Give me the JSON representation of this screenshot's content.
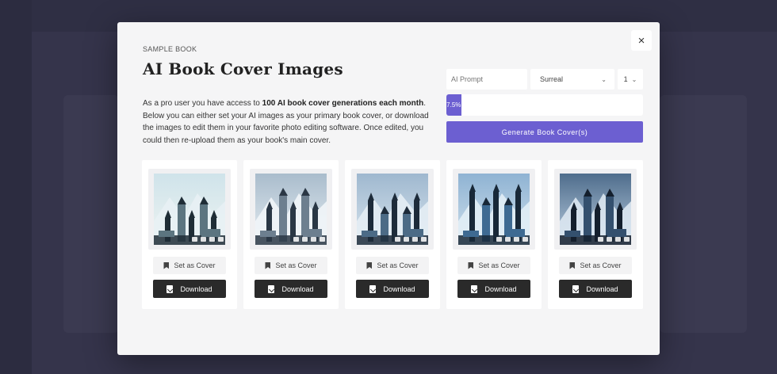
{
  "modal": {
    "eyebrow": "SAMPLE BOOK",
    "title": "AI Book Cover Images",
    "description_pre": "As a pro user you have access to ",
    "description_bold": "100 AI book cover generations each month",
    "description_post": ". Below you can either set your AI images as your primary book cover, or download the images to edit them in your favorite photo editing software. Once edited, you could then re-upload them as your book's main cover.",
    "close_icon": "×"
  },
  "controls": {
    "prompt_placeholder": "AI Prompt",
    "style_value": "Surreal",
    "count_value": "1",
    "progress_label": "7.5%",
    "progress_value": 0.075,
    "generate_label": "Generate Book Cover(s)",
    "accent": "#6c5fd1"
  },
  "cards": [
    {
      "set_cover_label": "Set as Cover",
      "download_label": "Download"
    },
    {
      "set_cover_label": "Set as Cover",
      "download_label": "Download"
    },
    {
      "set_cover_label": "Set as Cover",
      "download_label": "Download"
    },
    {
      "set_cover_label": "Set as Cover",
      "download_label": "Download"
    },
    {
      "set_cover_label": "Set as Cover",
      "download_label": "Download"
    }
  ]
}
